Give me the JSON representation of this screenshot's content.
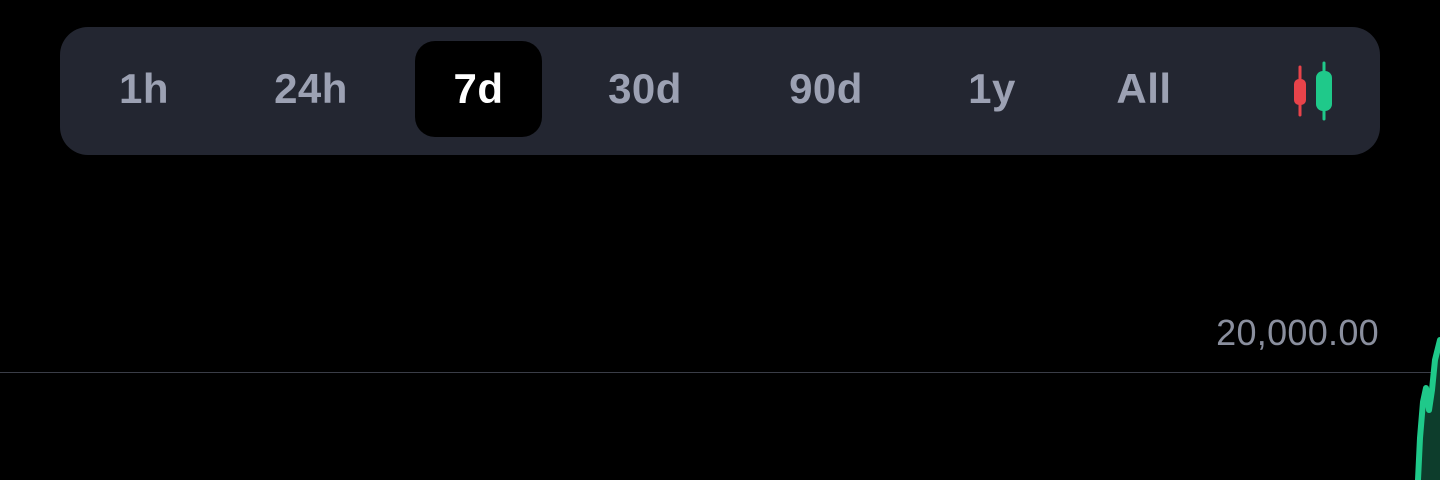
{
  "range_bar": {
    "options": [
      {
        "label": "1h",
        "active": false
      },
      {
        "label": "24h",
        "active": false
      },
      {
        "label": "7d",
        "active": true
      },
      {
        "label": "30d",
        "active": false
      },
      {
        "label": "90d",
        "active": false
      },
      {
        "label": "1y",
        "active": false
      },
      {
        "label": "All",
        "active": false
      }
    ],
    "chart_type_toggle_icon": "candlestick-icon"
  },
  "price_axis": {
    "label": "20,000.00"
  },
  "colors": {
    "background": "#000000",
    "bar_background": "#232631",
    "active_background": "#000000",
    "active_text": "#ffffff",
    "inactive_text": "#9ca1b3",
    "price_text": "#8a8f9e",
    "grid_line": "#3a3d47",
    "up_green": "#1fc98a",
    "down_red": "#e8434a"
  }
}
